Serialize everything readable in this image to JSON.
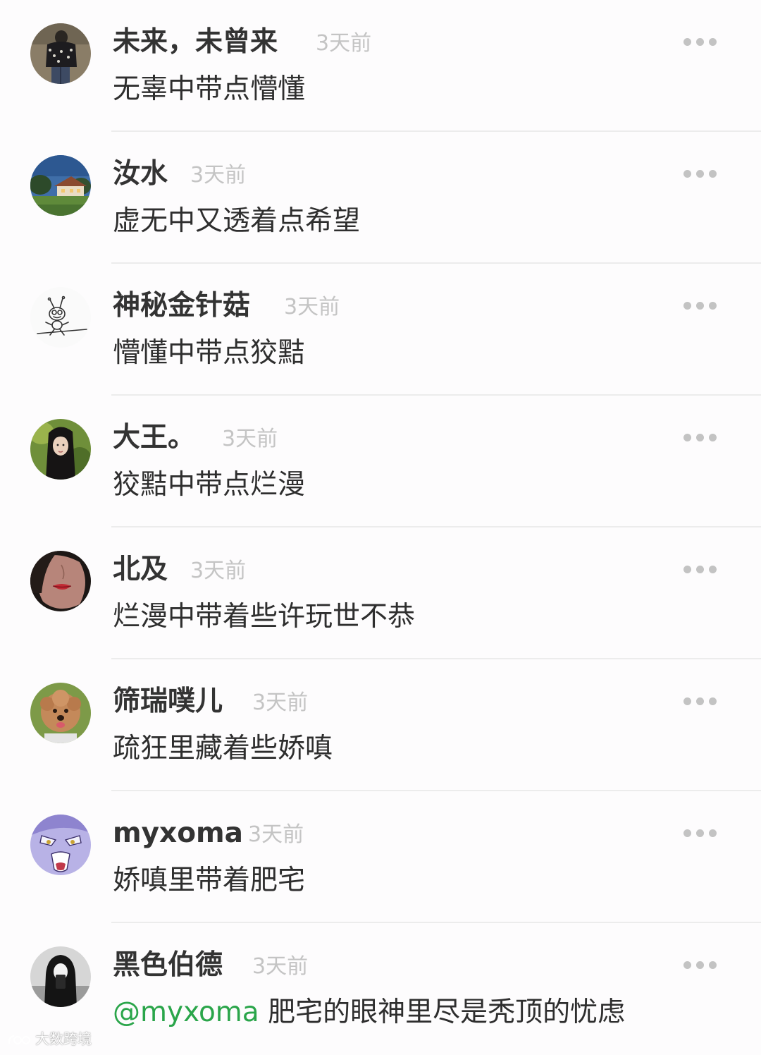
{
  "comments": [
    {
      "username": "未来，未曾来",
      "time": "3天前",
      "text": "无辜中带点懵懂",
      "avatar": "avatar-dark-figure"
    },
    {
      "username": "汝水",
      "time": "3天前",
      "text": "虚无中又透着点希望",
      "avatar": "avatar-house-landscape"
    },
    {
      "username": "神秘金针菇",
      "time": "3天前",
      "text": "懵懂中带点狡黠",
      "avatar": "avatar-ant-sketch"
    },
    {
      "username": "大王。",
      "time": "3天前",
      "text": "狡黠中带点烂漫",
      "avatar": "avatar-girl-portrait"
    },
    {
      "username": "北及",
      "time": "3天前",
      "text": "烂漫中带着些许玩世不恭",
      "avatar": "avatar-red-lips"
    },
    {
      "username": "筛瑞噗儿",
      "time": "3天前",
      "text": "疏狂里藏着些娇嗔",
      "avatar": "avatar-poodle-dog"
    },
    {
      "username": "myxoma",
      "time": "3天前",
      "text": "娇嗔里带着肥宅",
      "avatar": "avatar-anime-face"
    },
    {
      "username": "黑色伯德",
      "time": "3天前",
      "mention": "@myxoma",
      "text": " 肥宅的眼神里尽是秃顶的忧虑",
      "avatar": "avatar-hooded-figure"
    }
  ],
  "watermark": "大数跨境",
  "colors": {
    "background": "#fdfcfd",
    "username": "#333333",
    "timestamp": "#c4c4c4",
    "mention": "#2aa54a",
    "more_dots": "#c3c3c3",
    "divider": "#ececec"
  }
}
